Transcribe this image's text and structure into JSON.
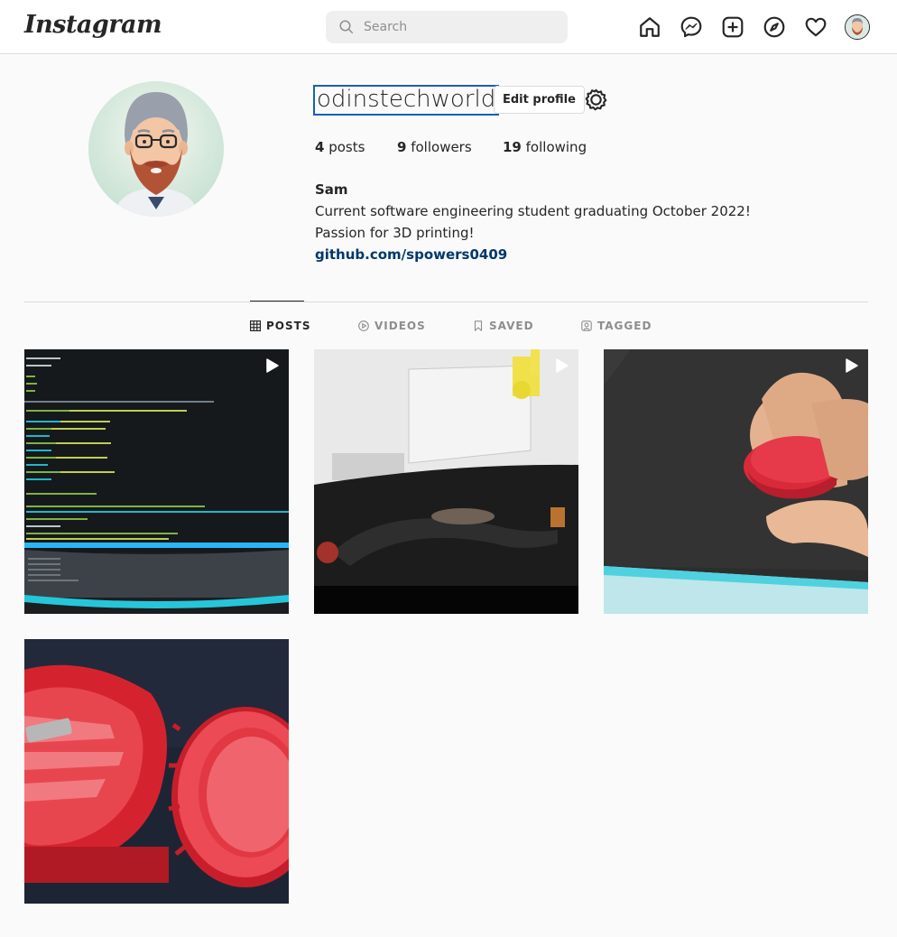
{
  "app": {
    "logo": "Instagram"
  },
  "search": {
    "placeholder": "Search"
  },
  "nav": [
    "home-icon",
    "messenger-icon",
    "new-post-icon",
    "explore-icon",
    "activity-heart-icon",
    "profile-avatar"
  ],
  "profile": {
    "username": "odinstechworld",
    "edit_label": "Edit profile",
    "stats": {
      "posts_count": "4",
      "posts_label": "posts",
      "followers_count": "9",
      "followers_label": "followers",
      "following_count": "19",
      "following_label": "following"
    },
    "name": "Sam",
    "bio_line1": "Current software engineering student graduating October 2022!",
    "bio_line2": "Passion for 3D printing!",
    "link": "github.com/spowers0409"
  },
  "tabs": [
    {
      "label": "POSTS",
      "icon": "grid-icon",
      "active": true
    },
    {
      "label": "VIDEOS",
      "icon": "play-circle-icon",
      "active": false
    },
    {
      "label": "SAVED",
      "icon": "bookmark-icon",
      "active": false
    },
    {
      "label": "TAGGED",
      "icon": "tag-person-icon",
      "active": false
    }
  ],
  "posts": [
    {
      "type": "video",
      "content": "code editor on monitor"
    },
    {
      "type": "video",
      "content": "3D printer build plate"
    },
    {
      "type": "video",
      "content": "red printed part in hand"
    },
    {
      "type": "image",
      "content": "red 3D printed gear parts"
    }
  ],
  "colors": {
    "link": "#00376b",
    "border": "#dbdbdb",
    "text": "#262626",
    "muted": "#8e8e8e",
    "focus": "#1a5fb4"
  }
}
